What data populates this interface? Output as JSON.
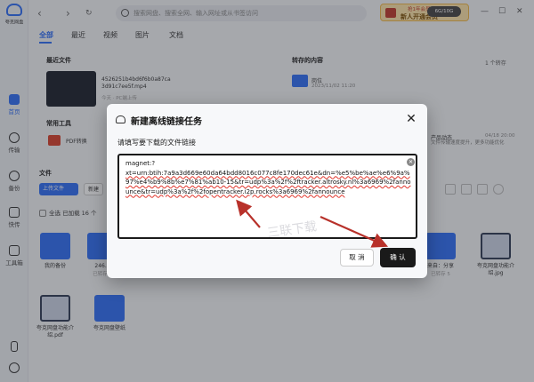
{
  "app": {
    "logo_text": "夸克网盘"
  },
  "sidebar": {
    "items": [
      {
        "label": "首页",
        "icon": "home-icon"
      },
      {
        "label": "传输",
        "icon": "transfer-icon"
      },
      {
        "label": "备份",
        "icon": "backup-icon"
      },
      {
        "label": "快传",
        "icon": "quick-send-icon"
      },
      {
        "label": "工具箱",
        "icon": "toolbox-icon"
      }
    ]
  },
  "topbar": {
    "search_placeholder": "搜索网盘、搜索全网、输入网址或从书签访问",
    "promo_small": "抢1年会员·专属",
    "promo_main": "新人开通会员",
    "storage": "6G/10G"
  },
  "tabs": [
    "全部",
    "最近",
    "视频",
    "图片",
    "文档"
  ],
  "recent": {
    "title": "最近文件",
    "file_name": "4526251b4bd6f6b0a87ca3d91c7ee5f.mp4",
    "file_sub": "今天 · PC端上传",
    "transfer_title": "转存的内容",
    "transfer_note": "1 个转存",
    "folder_name": "岗位",
    "folder_date": "2023/11/02 11:20"
  },
  "tools": {
    "title": "常用工具",
    "pdf_label": "PDF转换"
  },
  "news": {
    "title": "产品动态",
    "date": "04/18 20:00",
    "body": "文件传输速度提升，更多功能优化"
  },
  "files": {
    "title": "文件",
    "upload_btn": "上传文件",
    "new_btn": "新建",
    "select_all": "全选  已加载 16 个",
    "tiles": [
      {
        "name": "我的备份",
        "sub": ""
      },
      {
        "name": "246...",
        "sub": "已转存 6"
      },
      {
        "name": "",
        "sub": ""
      },
      {
        "name": "",
        "sub": ""
      },
      {
        "name": "",
        "sub": ""
      },
      {
        "name": "",
        "sub": ""
      },
      {
        "name": "来自：分享",
        "sub": "已转存 5"
      },
      {
        "name": "夸克网盘功能介绍.jpg",
        "sub": ""
      },
      {
        "name": "夸克网盘功能介绍.pdf",
        "sub": ""
      },
      {
        "name": "夸克网盘壁纸",
        "sub": ""
      }
    ]
  },
  "dialog": {
    "title": "新建离线链接任务",
    "label": "请填写要下载的文件链接",
    "link_first": "magnet:?",
    "link_body": "xt=urn:btih:7a9a3d669e60da64bdd8016c077c8fe170dec61e&dn=%e5%be%ae%e6%9a%97%e4%b9%8b%e7%81%ab10-15&tr=udp%3a%2f%2ftracker.altrosky.nl%3a6969%2fannounce&tr=udp%3a%2f%2fopentracker.i2p.rocks%3a6969%2fannounce",
    "cancel": "取 消",
    "confirm": "确 认",
    "watermark": "三联下载"
  }
}
